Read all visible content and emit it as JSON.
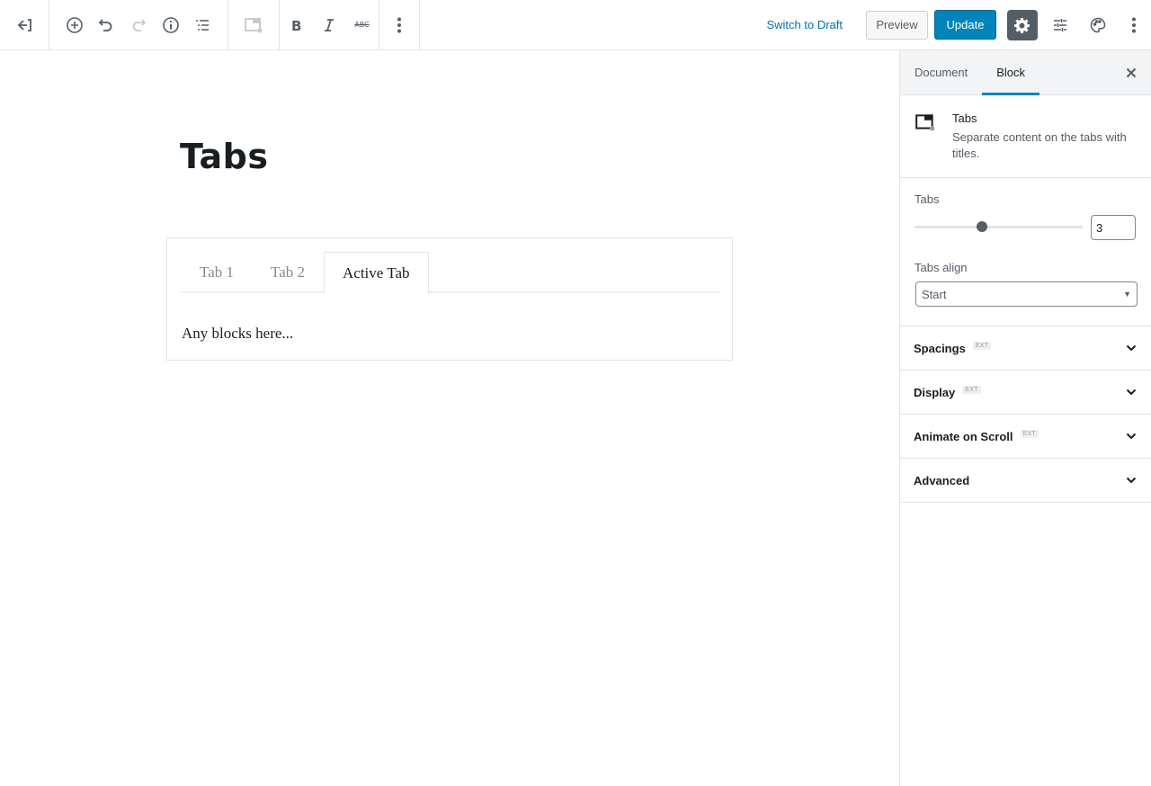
{
  "toolbar": {
    "back_icon": "fullscreen-exit-arrow-icon",
    "add_block_icon": "plus-circle-icon",
    "undo_icon": "undo-icon",
    "redo_icon": "redo-icon",
    "info_icon": "info-icon",
    "outline_icon": "block-navigation-icon",
    "block_type_icon": "tabs-block-icon",
    "bold_icon": "bold-icon",
    "italic_icon": "italic-icon",
    "strikethrough_label": "ABC",
    "more_icon": "more-vertical-icon",
    "switch_to_draft": "Switch to Draft",
    "preview": "Preview",
    "update": "Update",
    "settings_icon": "gear-icon",
    "sliders_icon": "sliders-icon",
    "palette_icon": "palette-icon",
    "options_icon": "more-vertical-icon"
  },
  "editor": {
    "post_title": "Tabs",
    "tabs_block": {
      "tabs": [
        {
          "label": "Tab 1",
          "active": false
        },
        {
          "label": "Tab 2",
          "active": false
        },
        {
          "label": "Active Tab",
          "active": true
        }
      ],
      "content": "Any blocks here..."
    }
  },
  "sidebar": {
    "tabs": [
      {
        "label": "Document",
        "active": false
      },
      {
        "label": "Block",
        "active": true
      }
    ],
    "close_icon": "close-icon",
    "block_card": {
      "title": "Tabs",
      "description": "Separate content on the tabs with titles."
    },
    "settings": {
      "tabs_label": "Tabs",
      "tabs_value": "3",
      "tabs_slider_fraction": 0.4,
      "tabs_align_label": "Tabs align",
      "tabs_align_value": "Start"
    },
    "panels": [
      {
        "title": "Spacings",
        "badge": "EXT"
      },
      {
        "title": "Display",
        "badge": "EXT"
      },
      {
        "title": "Animate on Scroll",
        "badge": "EXT"
      },
      {
        "title": "Advanced",
        "badge": ""
      }
    ]
  },
  "colors": {
    "accent": "#0085ba",
    "link": "#0073aa",
    "settings_active_bg": "#555d66"
  }
}
